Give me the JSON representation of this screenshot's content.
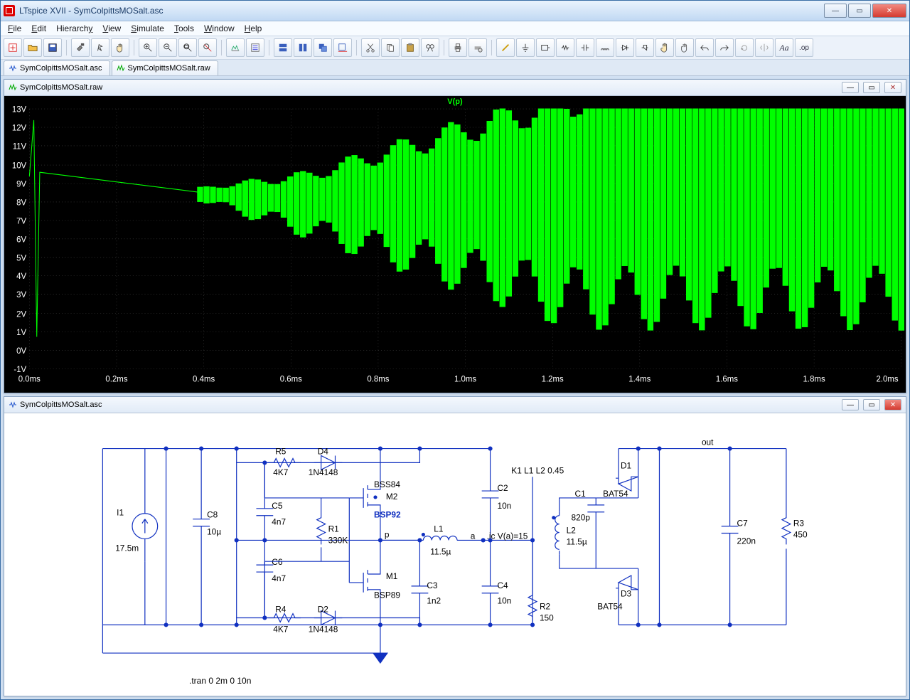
{
  "app": {
    "title": "LTspice XVII - SymColpittsMOSalt.asc"
  },
  "menu": {
    "file": "File",
    "edit": "Edit",
    "hierarchy": "Hierarchy",
    "view": "View",
    "simulate": "Simulate",
    "tools": "Tools",
    "window": "Window",
    "help": "Help"
  },
  "tabs": {
    "asc": "SymColpittsMOSalt.asc",
    "raw": "SymColpittsMOSalt.raw"
  },
  "rawpane": {
    "title": "SymColpittsMOSalt.raw",
    "trace": "V(p)"
  },
  "ascpane": {
    "title": "SymColpittsMOSalt.asc"
  },
  "tran": ".tran 0 2m 0 10n",
  "axes": {
    "y": [
      "13V",
      "12V",
      "11V",
      "10V",
      "9V",
      "8V",
      "7V",
      "6V",
      "5V",
      "4V",
      "3V",
      "2V",
      "1V",
      "0V",
      "-1V"
    ],
    "x": [
      "0.0ms",
      "0.2ms",
      "0.4ms",
      "0.6ms",
      "0.8ms",
      "1.0ms",
      "1.2ms",
      "1.4ms",
      "1.6ms",
      "1.8ms",
      "2.0ms"
    ]
  },
  "schem": {
    "I1": {
      "ref": "I1",
      "val": "17.5m"
    },
    "C8": {
      "ref": "C8",
      "val": "10µ"
    },
    "R5": {
      "ref": "R5",
      "val": "4K7"
    },
    "D4": {
      "ref": "D4",
      "val": "1N4148"
    },
    "C5": {
      "ref": "C5",
      "val": "4n7"
    },
    "C6": {
      "ref": "C6",
      "val": "4n7"
    },
    "R1": {
      "ref": "R1",
      "val": "330K"
    },
    "R4": {
      "ref": "R4",
      "val": "4K7"
    },
    "D2": {
      "ref": "D2",
      "val": "1N4148"
    },
    "M2": {
      "ref": "M2",
      "val": "BSS84",
      "alt": "BSP92"
    },
    "M1": {
      "ref": "M1",
      "val": "BSP89"
    },
    "L1": {
      "ref": "L1",
      "val": "11.5µ"
    },
    "C3": {
      "ref": "C3",
      "val": "1n2"
    },
    "C2": {
      "ref": "C2",
      "val": "10n"
    },
    "C4": {
      "ref": "C4",
      "val": "10n"
    },
    "R2": {
      "ref": "R2",
      "val": "150"
    },
    "K1": "K1 L1 L2 0.45",
    "ic": ".ic V(a)=15",
    "L2": {
      "ref": "L2",
      "val": "11.5µ"
    },
    "C1": {
      "ref": "C1",
      "val": "820p"
    },
    "D1": {
      "ref": "D1",
      "val": "BAT54"
    },
    "D3": {
      "ref": "D3",
      "val": "BAT54"
    },
    "C7": {
      "ref": "C7",
      "val": "220n"
    },
    "R3": {
      "ref": "R3",
      "val": "450"
    },
    "out": "out",
    "p": "p",
    "a": "a"
  }
}
